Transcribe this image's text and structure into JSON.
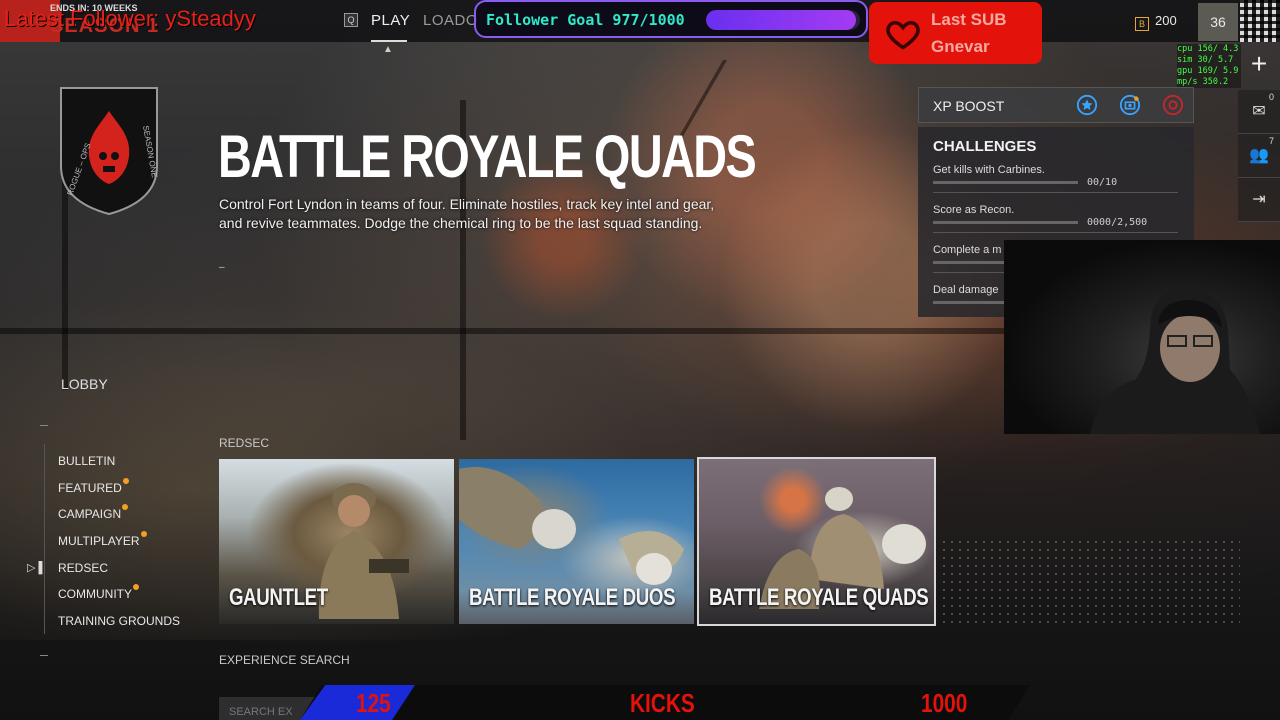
{
  "overlay": {
    "latest_follower": "Latest Follower: ySteadyy",
    "follower_goal": {
      "label": "Follower Goal 977/1000",
      "current": 977,
      "target": 1000
    },
    "last_sub": {
      "title": "Last SUB",
      "name": "Gnevar"
    },
    "stats": [
      "cpu 156/ 4.3",
      "sim  30/ 5.7",
      "gpu 169/ 5.9",
      "mp/s 350.2"
    ],
    "kicks": {
      "left": "125",
      "label": "KICKS",
      "right": "1000"
    }
  },
  "header": {
    "season_small": "ENDS IN: 10 WEEKS",
    "season_big": "SEASON 1",
    "key_hint": "Q",
    "tabs": [
      {
        "label": "PLAY",
        "active": true
      },
      {
        "label": "LOADO",
        "active": false
      }
    ],
    "currency": "200",
    "level": "36"
  },
  "emblem": {
    "text": "ROGUE – OPS  SEASON ONE"
  },
  "hero": {
    "title": "BATTLE ROYALE QUADS",
    "description": "Control Fort Lyndon in teams of four. Eliminate hostiles, track key intel and gear, and revive teammates. Dodge the chemical ring to be the last squad standing.",
    "dash": "–"
  },
  "xp_boost": {
    "title": "XP BOOST",
    "icons": [
      "star-badge-icon",
      "camera-badge-icon",
      "target-badge-icon"
    ]
  },
  "challenges": {
    "title": "CHALLENGES",
    "items": [
      {
        "label": "Get kills with Carbines.",
        "progress": "00/10"
      },
      {
        "label": "Score as Recon.",
        "progress": "0000/2,500"
      },
      {
        "label": "Complete a m",
        "progress": ""
      },
      {
        "label": "Deal damage",
        "progress": ""
      }
    ]
  },
  "side_icons": [
    {
      "name": "mail-icon",
      "glyph": "✉",
      "count": "0"
    },
    {
      "name": "party-icon",
      "glyph": "👥",
      "count": "7"
    },
    {
      "name": "exit-icon",
      "glyph": "⇥",
      "count": ""
    }
  ],
  "sidebar": {
    "lobby": "LOBBY",
    "items": [
      {
        "label": "BULLETIN",
        "dot": false
      },
      {
        "label": "FEATURED",
        "dot": true
      },
      {
        "label": "CAMPAIGN",
        "dot": true
      },
      {
        "label": "MULTIPLAYER",
        "dot": true
      },
      {
        "label": "REDSEC",
        "dot": false,
        "active": true
      },
      {
        "label": "COMMUNITY",
        "dot": true
      },
      {
        "label": "TRAINING GROUNDS",
        "dot": false
      }
    ]
  },
  "modes": {
    "section_label": "REDSEC",
    "cards": [
      {
        "title": "GAUNTLET"
      },
      {
        "title": "BATTLE ROYALE DUOS"
      },
      {
        "title": "BATTLE ROYALE QUADS",
        "selected": true
      }
    ]
  },
  "experience": {
    "label": "EXPERIENCE SEARCH",
    "search_placeholder": "SEARCH EX"
  },
  "colors": {
    "accent_red": "#e3120b",
    "goal_teal": "#2ee9c9",
    "goal_purple": "#8a5cf0",
    "notify_orange": "#f2a023"
  }
}
